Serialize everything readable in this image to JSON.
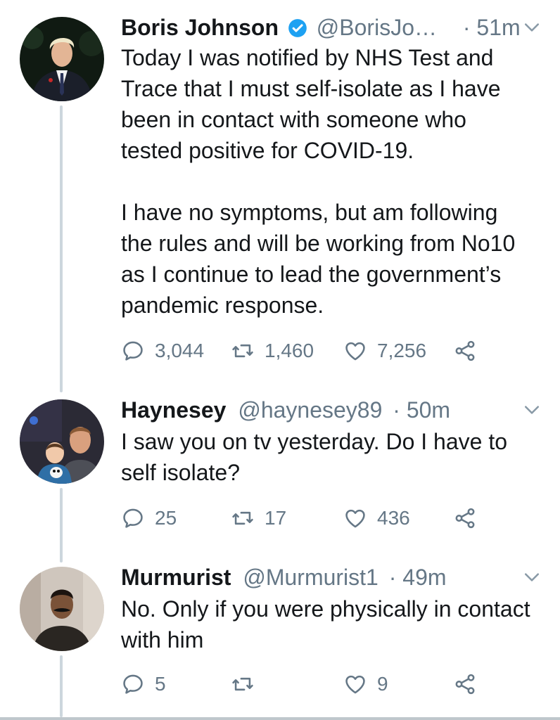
{
  "tweets": [
    {
      "name": "Boris Johnson",
      "verified": true,
      "handle": "@BorisJo…",
      "time": "· 51m",
      "text": "Today I was notified by NHS Test and\nTrace that I must self-isolate as I have\nbeen in contact with someone who\ntested positive for COVID-19.\n\nI have no symptoms, but am following\nthe rules and will be working from No10\nas I continue to lead the government’s\npandemic response.",
      "replies": "3,044",
      "retweets": "1,460",
      "likes": "7,256"
    },
    {
      "name": "Haynesey",
      "verified": false,
      "handle": "@haynesey89",
      "time": "· 50m",
      "text": "I saw you on tv yesterday. Do I have to\nself isolate?",
      "replies": "25",
      "retweets": "17",
      "likes": "436"
    },
    {
      "name": "Murmurist",
      "verified": false,
      "handle": "@Murmurist1",
      "time": "· 49m",
      "text": "No. Only if you were physically in contact\nwith him",
      "replies": "5",
      "retweets": "",
      "likes": "9"
    }
  ],
  "colors": {
    "text": "#14171a",
    "meta": "#657786",
    "verified": "#1da1f2",
    "thread_line": "#ccd6dd"
  },
  "icons": [
    "reply-icon",
    "retweet-icon",
    "like-icon",
    "share-icon",
    "chevron-down-icon",
    "verified-badge-icon"
  ]
}
